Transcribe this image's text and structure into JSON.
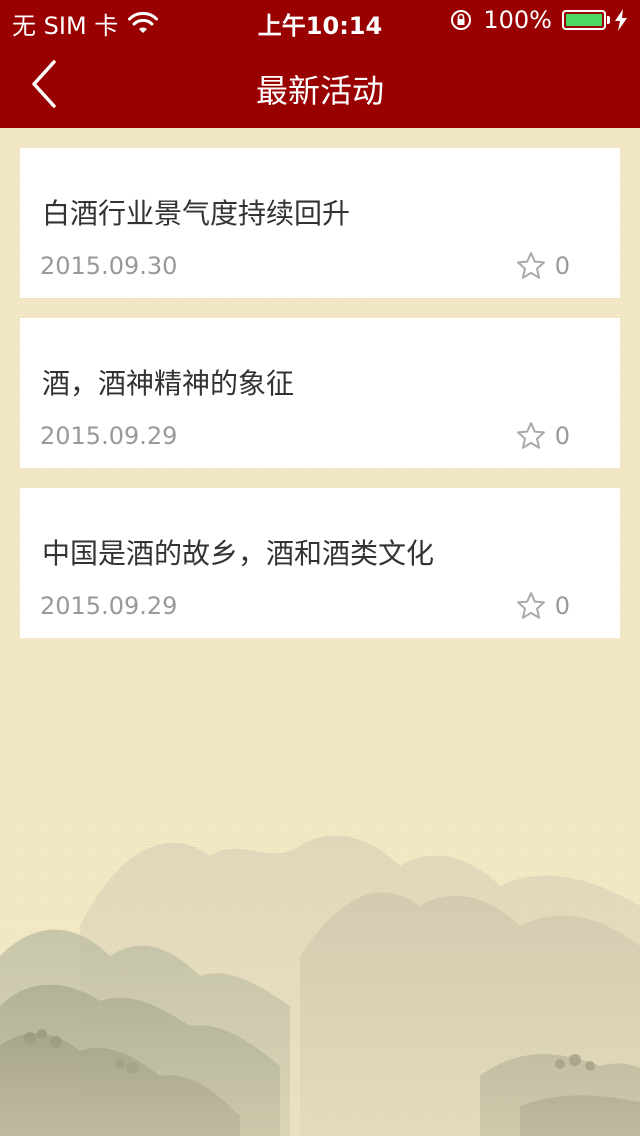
{
  "status_bar": {
    "carrier": "无 SIM 卡",
    "time": "上午10:14",
    "battery_percent": "100%",
    "battery_level": 1.0
  },
  "nav": {
    "title": "最新活动",
    "back_icon": "chevron-left-icon"
  },
  "articles": [
    {
      "title": "白酒行业景气度持续回升",
      "date": "2015.09.30",
      "favorites": "0"
    },
    {
      "title": "酒，酒神精神的象征",
      "date": "2015.09.29",
      "favorites": "0"
    },
    {
      "title": "中国是酒的故乡，酒和酒类文化",
      "date": "2015.09.29",
      "favorites": "0"
    }
  ],
  "colors": {
    "nav_background": "#990000",
    "page_background": "#f3e9c6",
    "battery_fill": "#4cd964"
  }
}
